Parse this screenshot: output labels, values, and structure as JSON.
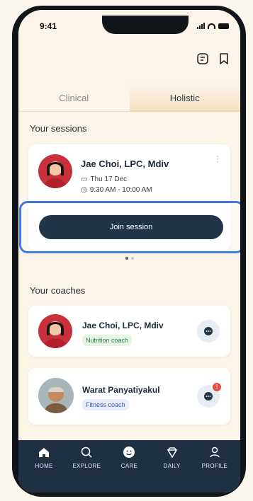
{
  "status": {
    "time": "9:41"
  },
  "tabs": [
    {
      "label": "Clinical"
    },
    {
      "label": "Holistic"
    }
  ],
  "sessions": {
    "title": "Your sessions",
    "card": {
      "name": "Jae Choi, LPC, Mdiv",
      "date": "Thu 17 Dec",
      "time": "9:30 AM - 10:00 AM",
      "join_label": "Join session"
    }
  },
  "coaches": {
    "title": "Your coaches",
    "items": [
      {
        "name": "Jae Choi, LPC, Mdiv",
        "role": "Nutrition coach",
        "tag_bg": "#e6f4e8",
        "tag_color": "#2f7a3d"
      },
      {
        "name": "Warat Panyatiyakul",
        "role": "Fitness coach",
        "tag_bg": "#e8eefc",
        "tag_color": "#3b5aa8",
        "badge": "1"
      }
    ]
  },
  "nav": [
    {
      "label": "HOME",
      "icon": "home-icon"
    },
    {
      "label": "EXPLORE",
      "icon": "search-icon"
    },
    {
      "label": "CARE",
      "icon": "care-face-icon"
    },
    {
      "label": "DAILY",
      "icon": "diamond-icon"
    },
    {
      "label": "PROFILE",
      "icon": "profile-icon"
    }
  ],
  "colors": {
    "accent": "#223448",
    "highlight": "#3f7ee0",
    "background": "#fbf4e9"
  }
}
